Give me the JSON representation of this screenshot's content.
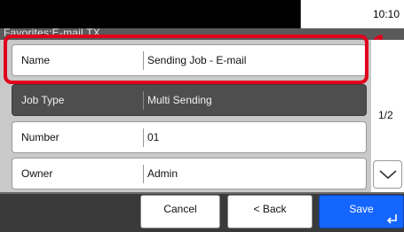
{
  "status": {
    "time": "10:10"
  },
  "header": {
    "title": "Favorites:E-mail TX"
  },
  "rows": [
    {
      "label": "Name",
      "value": "Sending Job - E-mail"
    },
    {
      "label": "Job Type",
      "value": "Multi Sending"
    },
    {
      "label": "Number",
      "value": "01"
    },
    {
      "label": "Owner",
      "value": "Admin"
    }
  ],
  "callout": "1",
  "pager": {
    "page": "1/2"
  },
  "icons": {
    "scroll_down": "chevron-down-icon",
    "enter": "enter-return-icon"
  },
  "buttons": {
    "cancel": "Cancel",
    "back": "< Back",
    "save": "Save"
  },
  "colors": {
    "highlight": "#e0001b",
    "save_button": "#1565ff",
    "selected_row": "#4e4e4e"
  }
}
